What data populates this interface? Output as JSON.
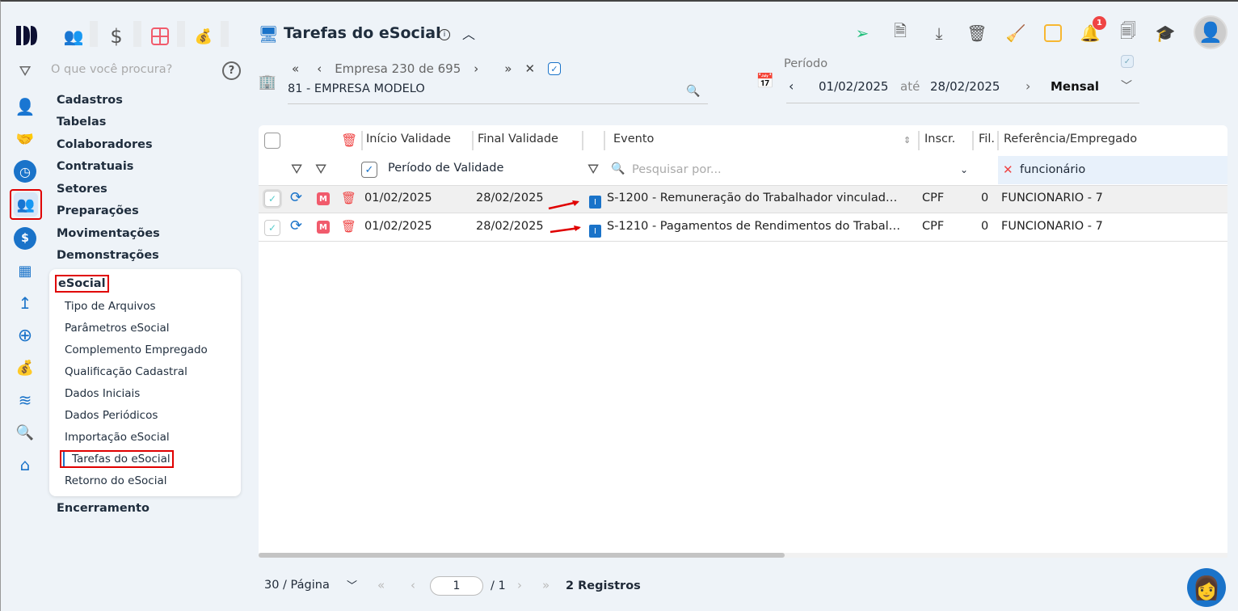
{
  "top_tabs": [
    "people-icon",
    "dollar-icon",
    "calculator-icon",
    "money-bag-icon"
  ],
  "search": {
    "placeholder": "O que você procura?"
  },
  "menu": {
    "items": [
      "Cadastros",
      "Tabelas",
      "Colaboradores",
      "Contratuais",
      "Setores",
      "Preparações",
      "Movimentações",
      "Demonstrações"
    ],
    "esocial": {
      "label": "eSocial",
      "children": [
        "Tipo de Arquivos",
        "Parâmetros eSocial",
        "Complemento Empregado",
        "Qualificação Cadastral",
        "Dados Iniciais",
        "Dados Periódicos",
        "Importação eSocial",
        "Tarefas do eSocial",
        "Retorno do eSocial"
      ],
      "active": "Tarefas do eSocial"
    },
    "last": "Encerramento"
  },
  "header": {
    "title": "Tarefas do eSocial",
    "notification_count": "1"
  },
  "company": {
    "nav_label": "Empresa",
    "current": "230",
    "of": "de",
    "total": "695",
    "value": "81 - EMPRESA MODELO"
  },
  "period": {
    "label": "Período",
    "from": "01/02/2025",
    "sep": "até",
    "to": "28/02/2025",
    "mode": "Mensal"
  },
  "table": {
    "headers": [
      "Início Validade",
      "Final Validade",
      "Evento",
      "Inscr.",
      "Fil.",
      "Referência/Empregado"
    ],
    "filter": {
      "period_label": "Período de Validade",
      "search_placeholder": "Pesquisar por...",
      "ref_filter": "funcionário"
    },
    "rows": [
      {
        "inicio": "01/02/2025",
        "final": "28/02/2025",
        "badge": "I",
        "evento": "S-1200 - Remuneração do Trabalhador vinculad…",
        "inscr": "CPF",
        "fil": "0",
        "ref": "FUNCIONARIO - 7"
      },
      {
        "inicio": "01/02/2025",
        "final": "28/02/2025",
        "badge": "I",
        "evento": "S-1210 - Pagamentos de Rendimentos do Trabal…",
        "inscr": "CPF",
        "fil": "0",
        "ref": "FUNCIONARIO - 7"
      }
    ]
  },
  "pagination": {
    "page_size": "30 / Página",
    "page": "1",
    "total_pages": "/ 1",
    "records": "2 Registros"
  },
  "colors": {
    "accent": "#1a73c9",
    "danger": "#ef4444",
    "highlight": "#e00000"
  }
}
